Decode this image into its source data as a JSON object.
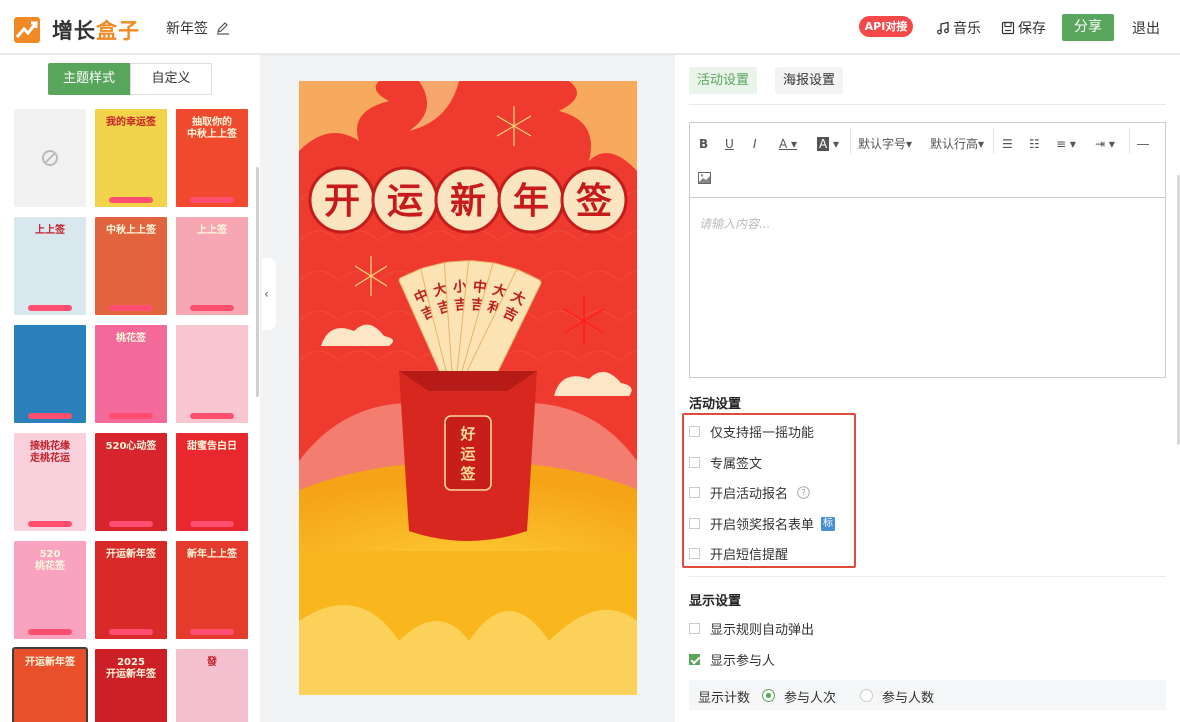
{
  "header": {
    "logo_a": "增长",
    "logo_b": "盒子",
    "doc_title": "新年签",
    "api_badge": "API对接",
    "music": "音乐",
    "save": "保存",
    "share": "分享",
    "logout": "退出"
  },
  "left": {
    "tab_theme": "主题样式",
    "tab_custom": "自定义",
    "thumbs": [
      {
        "title": "",
        "bg": "#f1f1f1"
      },
      {
        "title": "我的幸运签",
        "bg": "#f3d34a"
      },
      {
        "title": "抽取你的\n中秋上上签",
        "bg": "#f04a2e"
      },
      {
        "title": "上上签",
        "bg": "#d9e7ee"
      },
      {
        "title": "中秋上上签",
        "bg": "#e2643e"
      },
      {
        "title": "上上签",
        "bg": "#f7a6b4"
      },
      {
        "title": "",
        "bg": "#2a80b9"
      },
      {
        "title": "桃花签",
        "bg": "#f36a9a"
      },
      {
        "title": "",
        "bg": "#f7c6d1"
      },
      {
        "title": "接桃花缘\n走桃花运",
        "bg": "#f9d0dc"
      },
      {
        "title": "520心动签",
        "bg": "#d8242c"
      },
      {
        "title": "甜蜜告白日",
        "bg": "#e8282e"
      },
      {
        "title": "520\n桃花签",
        "bg": "#f9a3c1"
      },
      {
        "title": "开运新年签",
        "bg": "#d82a28"
      },
      {
        "title": "新年上上签",
        "bg": "#e53b2c"
      },
      {
        "title": "开运新年签",
        "bg": "#e8502b"
      },
      {
        "title": "2025\n开运新年签",
        "bg": "#cc1f26"
      },
      {
        "title": "發",
        "bg": "#f3c0d0"
      }
    ]
  },
  "poster": {
    "title_chars": [
      "开",
      "运",
      "新",
      "年",
      "签"
    ],
    "sticks": [
      "中吉",
      "大吉",
      "小吉",
      "中吉",
      "大利",
      "大吉"
    ],
    "cup_text": "好运签"
  },
  "right": {
    "tab_activity": "活动设置",
    "tab_poster": "海报设置",
    "toolbar": {
      "bold": "B",
      "underline": "U",
      "italic": "I",
      "font_color": "A",
      "bg_color": "A",
      "font_size": "默认字号",
      "line_height": "默认行高"
    },
    "editor_placeholder": "请输入内容...",
    "activity_section": "活动设置",
    "options": [
      {
        "label": "仅支持摇一摇功能",
        "checked": false
      },
      {
        "label": "专属签文",
        "checked": false
      },
      {
        "label": "开启活动报名",
        "checked": false
      },
      {
        "label": "开启领奖报名表单",
        "checked": false,
        "badge": "标"
      },
      {
        "label": "开启短信提醒",
        "checked": false
      }
    ],
    "display_section": "显示设置",
    "display_options": [
      {
        "label": "显示规则自动弹出",
        "checked": false
      },
      {
        "label": "显示参与人",
        "checked": true
      }
    ],
    "count_label": "显示计数",
    "count_options": [
      {
        "label": "参与人次",
        "selected": true
      },
      {
        "label": "参与人数",
        "selected": false
      }
    ]
  },
  "colors": {
    "brand_green": "#58a55c",
    "api_red": "#f5484b",
    "highlight_red": "#e04c3c",
    "poster_red": "#ef3b2f"
  }
}
